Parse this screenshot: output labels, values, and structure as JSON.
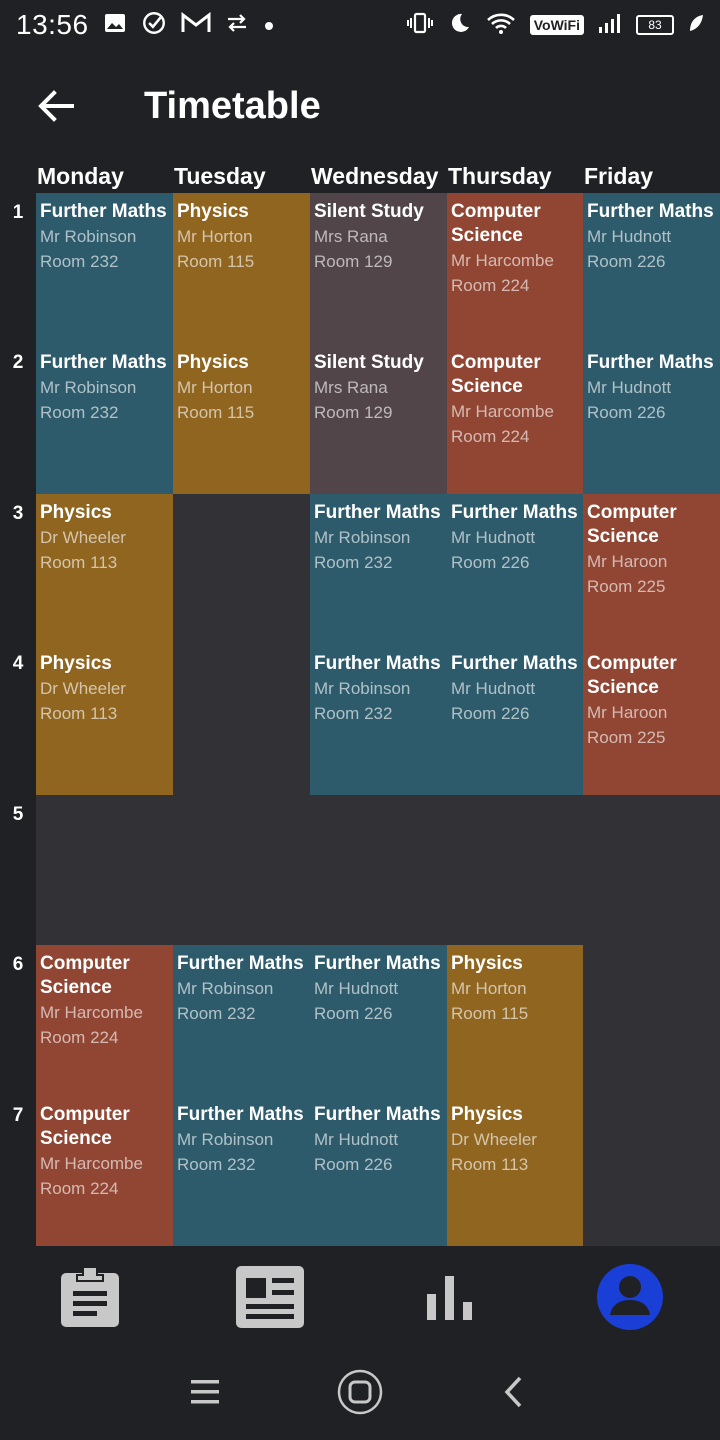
{
  "status": {
    "time": "13:56",
    "network_tag": "VoWiFi",
    "battery": "83",
    "left_icons": [
      "gallery-icon",
      "check-circle-icon",
      "gmail-icon",
      "data-transfer-icon",
      "dot-icon"
    ],
    "right_icons": [
      "vibrate-icon",
      "moon-icon",
      "wifi-icon",
      "signal-icon",
      "leaf-icon"
    ]
  },
  "header": {
    "title": "Timetable"
  },
  "days": [
    "Monday",
    "Tuesday",
    "Wednesday",
    "Thursday",
    "Friday"
  ],
  "periods": [
    "1",
    "2",
    "3",
    "4",
    "5",
    "6",
    "7"
  ],
  "colors": {
    "Further Maths": "#2d5b6b",
    "Physics": "#8f6520",
    "Silent Study": "#514549",
    "Computer Science": "#904633"
  },
  "timetable": {
    "monday": [
      {
        "subject": "Further Maths",
        "teacher": "Mr Robinson",
        "room": "Room 232"
      },
      {
        "subject": "Further Maths",
        "teacher": "Mr Robinson",
        "room": "Room 232"
      },
      {
        "subject": "Physics",
        "teacher": "Dr Wheeler",
        "room": "Room 113"
      },
      {
        "subject": "Physics",
        "teacher": "Dr Wheeler",
        "room": "Room 113"
      },
      null,
      {
        "subject": "Computer Science",
        "teacher": "Mr Harcombe",
        "room": "Room 224"
      },
      {
        "subject": "Computer Science",
        "teacher": "Mr Harcombe",
        "room": "Room 224"
      }
    ],
    "tuesday": [
      {
        "subject": "Physics",
        "teacher": "Mr Horton",
        "room": "Room 115"
      },
      {
        "subject": "Physics",
        "teacher": "Mr Horton",
        "room": "Room 115"
      },
      null,
      null,
      null,
      {
        "subject": "Further Maths",
        "teacher": "Mr Robinson",
        "room": "Room 232"
      },
      {
        "subject": "Further Maths",
        "teacher": "Mr Robinson",
        "room": "Room 232"
      }
    ],
    "wednesday": [
      {
        "subject": "Silent Study",
        "teacher": "Mrs Rana",
        "room": "Room 129"
      },
      {
        "subject": "Silent Study",
        "teacher": "Mrs Rana",
        "room": "Room 129"
      },
      {
        "subject": "Further Maths",
        "teacher": "Mr Robinson",
        "room": "Room 232"
      },
      {
        "subject": "Further Maths",
        "teacher": "Mr Robinson",
        "room": "Room 232"
      },
      null,
      {
        "subject": "Further Maths",
        "teacher": "Mr Hudnott",
        "room": "Room 226"
      },
      {
        "subject": "Further Maths",
        "teacher": "Mr Hudnott",
        "room": "Room 226"
      }
    ],
    "thursday": [
      {
        "subject": "Computer Science",
        "teacher": "Mr Harcombe",
        "room": "Room 224"
      },
      {
        "subject": "Computer Science",
        "teacher": "Mr Harcombe",
        "room": "Room 224"
      },
      {
        "subject": "Further Maths",
        "teacher": "Mr Hudnott",
        "room": "Room 226"
      },
      {
        "subject": "Further Maths",
        "teacher": "Mr Hudnott",
        "room": "Room 226"
      },
      null,
      {
        "subject": "Physics",
        "teacher": "Mr Horton",
        "room": "Room 115"
      },
      {
        "subject": "Physics",
        "teacher": "Dr Wheeler",
        "room": "Room 113"
      }
    ],
    "friday": [
      {
        "subject": "Further Maths",
        "teacher": "Mr Hudnott",
        "room": "Room 226"
      },
      {
        "subject": "Further Maths",
        "teacher": "Mr Hudnott",
        "room": "Room 226"
      },
      {
        "subject": "Computer Science",
        "teacher": "Mr Haroon",
        "room": "Room 225"
      },
      {
        "subject": "Computer Science",
        "teacher": "Mr Haroon",
        "room": "Room 225"
      },
      null,
      null,
      null
    ]
  },
  "bottom_nav": {
    "items": [
      {
        "name": "clipboard-icon",
        "active": false
      },
      {
        "name": "news-icon",
        "active": false
      },
      {
        "name": "bar-chart-icon",
        "active": false
      },
      {
        "name": "profile-icon",
        "active": true
      }
    ],
    "active_color": "#1a3fd6",
    "inactive_color": "#c8c8c8"
  },
  "system_nav": [
    "recents-icon",
    "home-icon",
    "back-icon"
  ]
}
